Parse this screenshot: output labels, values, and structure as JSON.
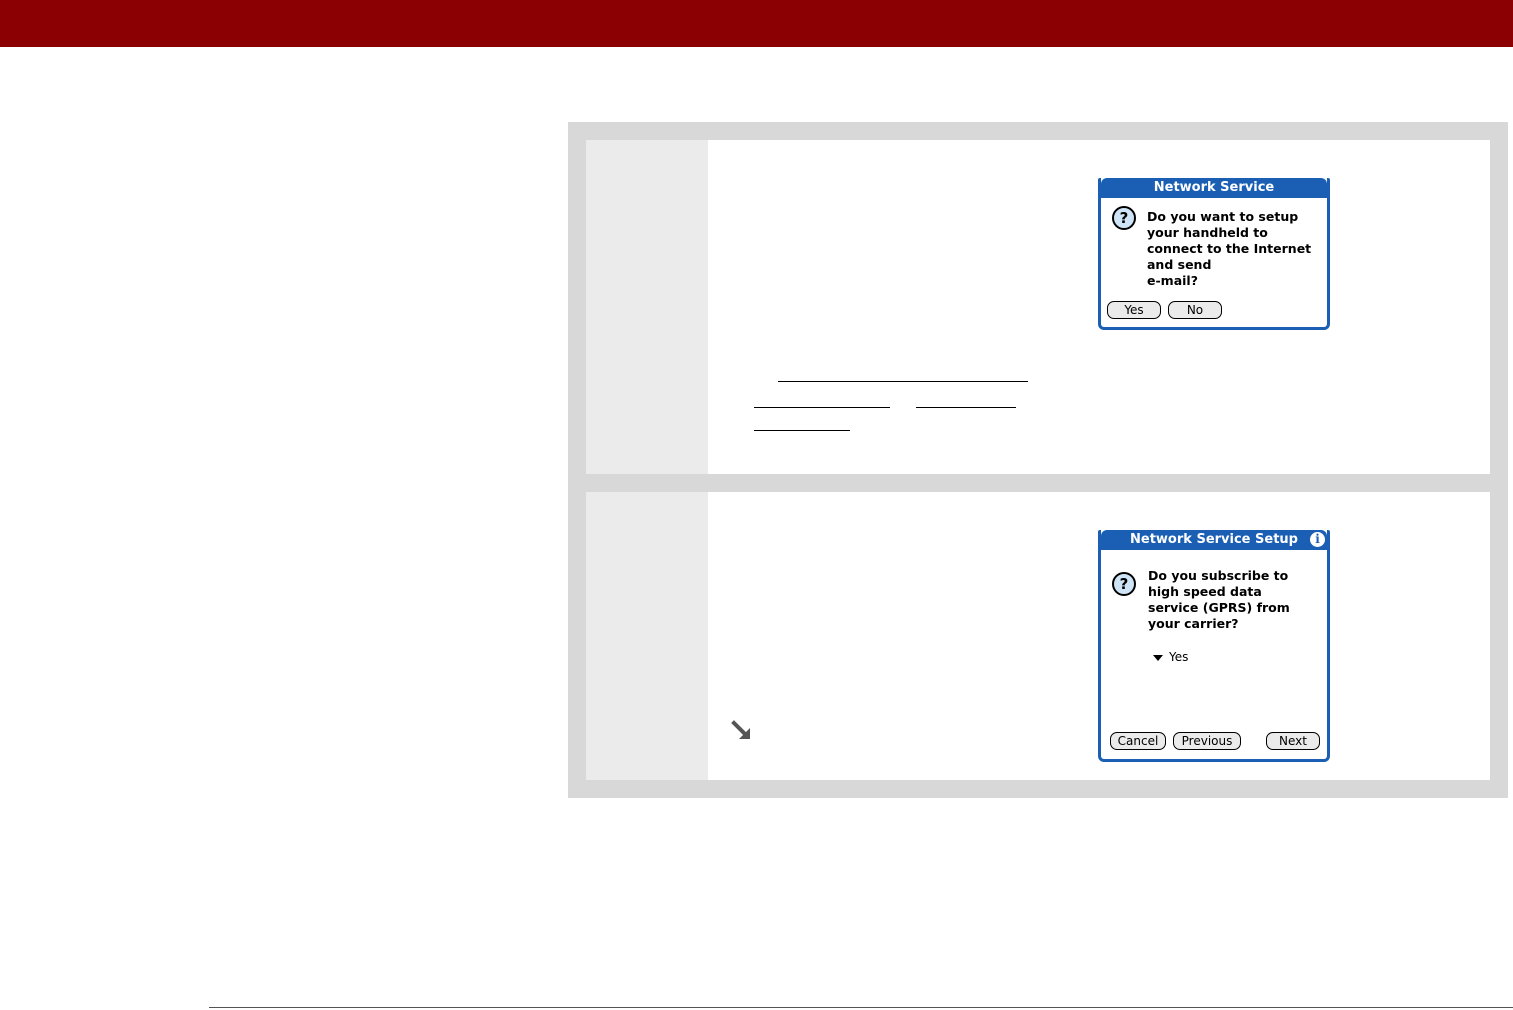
{
  "dialog1": {
    "title": "Network Service",
    "message": "Do you want to setup\nyour handheld to\nconnect to the Internet\nand send\ne-mail?",
    "buttons": {
      "yes": "Yes",
      "no": "No"
    },
    "icon": "question-icon"
  },
  "dialog2": {
    "title": "Network Service Setup",
    "message": "Do you subscribe to\nhigh speed data\nservice (GPRS) from\nyour carrier?",
    "picker_value": "Yes",
    "buttons": {
      "cancel": "Cancel",
      "previous": "Previous",
      "next": "Next"
    },
    "icons": [
      "question-icon",
      "info-icon"
    ]
  },
  "colors": {
    "banner": "#8b0103",
    "dialog_accent": "#1a5fb4",
    "panel": "#d8d8d8"
  }
}
